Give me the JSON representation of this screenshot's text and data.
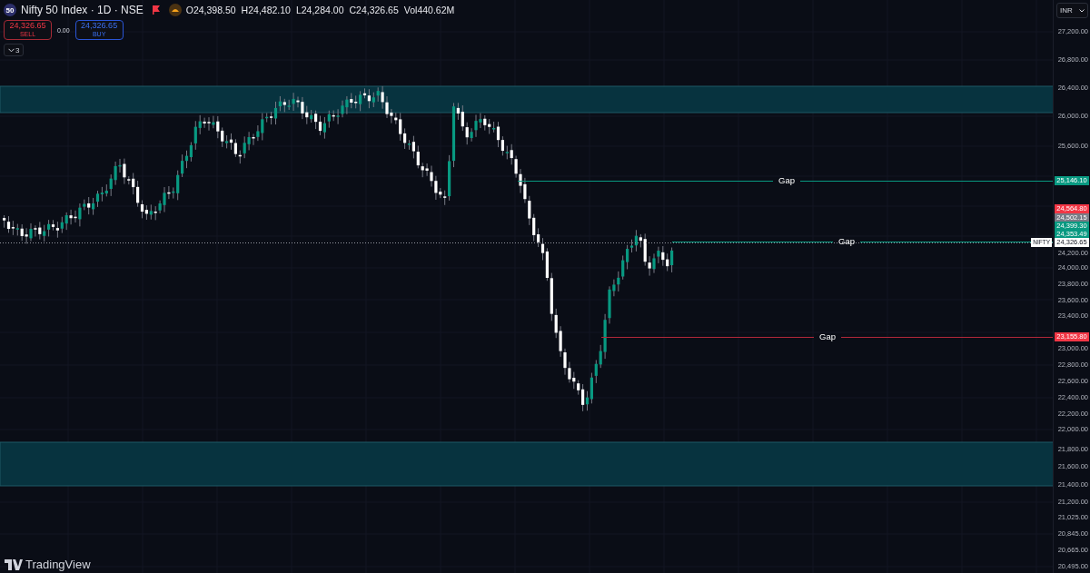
{
  "header": {
    "symbol_badge": "50",
    "title": "Nifty 50 Index · 1D · NSE",
    "ohlc": [
      {
        "label": "O",
        "value": "24,398.50"
      },
      {
        "label": "H",
        "value": "24,482.10"
      },
      {
        "label": "L",
        "value": "24,284.00"
      },
      {
        "label": "C",
        "value": "24,326.65"
      }
    ],
    "volume": {
      "label": "Vol",
      "value": "440.62M"
    }
  },
  "trade": {
    "sell": {
      "price": "24,326.65",
      "label": "SELL"
    },
    "spread": "0.00",
    "buy": {
      "price": "24,326.65",
      "label": "BUY"
    }
  },
  "indicators_toggle": {
    "count": "3"
  },
  "currency": "INR",
  "price_axis": {
    "ticks": [
      "27,200.00",
      "26,800.00",
      "26,400.00",
      "26,000.00",
      "25,600.00",
      "24,200.00",
      "24,000.00",
      "23,800.00",
      "23,600.00",
      "23,400.00",
      "23,000.00",
      "22,800.00",
      "22,600.00",
      "22,400.00",
      "22,200.00",
      "22,000.00",
      "21,800.00",
      "21,600.00",
      "21,400.00",
      "21,200.00",
      "21,025.00",
      "20,845.00",
      "20,665.00",
      "20,495.00"
    ]
  },
  "price_labels": [
    {
      "value": "25,146.10",
      "color": "#089981"
    },
    {
      "value": "24,564.80",
      "color": "#f23645"
    },
    {
      "value": "24,502.15",
      "color": "#787b86"
    },
    {
      "value": "24,399.30",
      "color": "#089981"
    },
    {
      "value": "24,353.49",
      "color": "#089981"
    },
    {
      "value": "24,326.65",
      "color": "#ffffff",
      "tag": "NIFTY"
    },
    {
      "value": "23,155.80",
      "color": "#f23645"
    }
  ],
  "gap_lines": [
    {
      "label": "Gap",
      "color": "#089981"
    },
    {
      "label": "Gap",
      "color": "#089981"
    },
    {
      "label": "Gap",
      "color": "#b2283a"
    }
  ],
  "logo": "TradingView"
}
